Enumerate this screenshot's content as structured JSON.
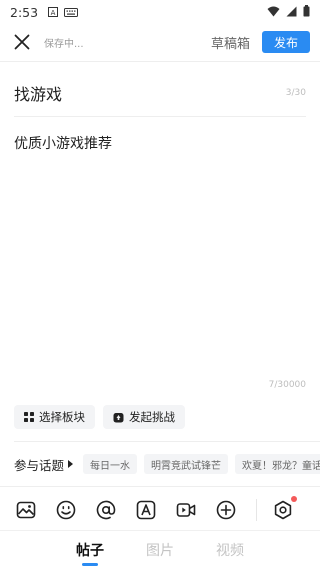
{
  "status": {
    "time": "2:53"
  },
  "header": {
    "saving_text": "保存中...",
    "drafts_label": "草稿箱",
    "publish_label": "发布"
  },
  "editor": {
    "title": "找游戏",
    "title_count": "3/30",
    "body": "优质小游戏推荐",
    "body_count": "7/30000"
  },
  "chips": [
    {
      "label": "选择板块",
      "icon": "grid-icon"
    },
    {
      "label": "发起挑战",
      "icon": "challenge-icon"
    }
  ],
  "topics": {
    "label": "参与话题",
    "items": [
      "每日一水",
      "明霄竞武试锋芒",
      "欢夏！邪龙？童话区"
    ]
  },
  "toolbar_icons": [
    "image-icon",
    "emoji-icon",
    "mention-icon",
    "text-format-icon",
    "video-icon",
    "add-icon",
    "settings-icon"
  ],
  "tabs": [
    {
      "label": "帖子",
      "active": true
    },
    {
      "label": "图片",
      "active": false
    },
    {
      "label": "视频",
      "active": false
    }
  ],
  "colors": {
    "accent": "#2a8bf2",
    "badge": "#f45a5a"
  }
}
